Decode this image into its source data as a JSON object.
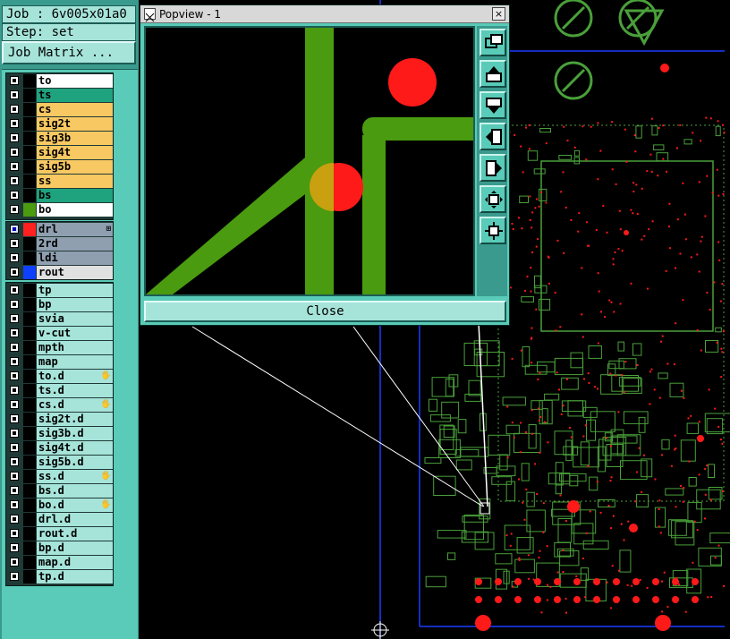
{
  "job": {
    "label": "Job : 6v005x01a0",
    "step": "Step: set"
  },
  "job_matrix_label": "Job Matrix ...",
  "layers": [
    {
      "name": "to",
      "color": "#ffffff",
      "swatch": "#000000",
      "group": 0
    },
    {
      "name": "ts",
      "color": "#1fa37e",
      "swatch": "#000000",
      "group": 0
    },
    {
      "name": "cs",
      "color": "#f8c862",
      "swatch": "#000000",
      "group": 0
    },
    {
      "name": "sig2t",
      "color": "#f8c862",
      "swatch": "#000000",
      "group": 0
    },
    {
      "name": "sig3b",
      "color": "#f8c862",
      "swatch": "#000000",
      "group": 0
    },
    {
      "name": "sig4t",
      "color": "#f8c862",
      "swatch": "#000000",
      "group": 0
    },
    {
      "name": "sig5b",
      "color": "#f8c862",
      "swatch": "#000000",
      "group": 0
    },
    {
      "name": "ss",
      "color": "#f8c862",
      "swatch": "#000000",
      "group": 0
    },
    {
      "name": "bs",
      "color": "#1fa37e",
      "swatch": "#000000",
      "group": 0
    },
    {
      "name": "bo",
      "color": "#ffffff",
      "swatch": "#4a9b10",
      "group": 0
    },
    {
      "name": "drl",
      "color": "#8f9fb0",
      "swatch": "#ff2020",
      "group": 1,
      "selected": true,
      "icon": "⊞"
    },
    {
      "name": "2rd",
      "color": "#8f9fb0",
      "swatch": "#000000",
      "group": 1
    },
    {
      "name": "ldi",
      "color": "#8f9fb0",
      "swatch": "#000000",
      "group": 1
    },
    {
      "name": "rout",
      "color": "#e0e0e0",
      "swatch": "#1040ff",
      "group": 1
    },
    {
      "name": "tp",
      "color": "#a6e4da",
      "swatch": "#000000",
      "group": 2
    },
    {
      "name": "bp",
      "color": "#a6e4da",
      "swatch": "#000000",
      "group": 2
    },
    {
      "name": "svia",
      "color": "#a6e4da",
      "swatch": "#000000",
      "group": 2
    },
    {
      "name": "v-cut",
      "color": "#a6e4da",
      "swatch": "#000000",
      "group": 2
    },
    {
      "name": "mpth",
      "color": "#a6e4da",
      "swatch": "#000000",
      "group": 2
    },
    {
      "name": "map",
      "color": "#a6e4da",
      "swatch": "#000000",
      "group": 2
    },
    {
      "name": "to.d",
      "color": "#a6e4da",
      "swatch": "#000000",
      "group": 2,
      "icon": "🖐"
    },
    {
      "name": "ts.d",
      "color": "#a6e4da",
      "swatch": "#000000",
      "group": 2
    },
    {
      "name": "cs.d",
      "color": "#a6e4da",
      "swatch": "#000000",
      "group": 2,
      "icon": "🖐"
    },
    {
      "name": "sig2t.d",
      "color": "#a6e4da",
      "swatch": "#000000",
      "group": 2
    },
    {
      "name": "sig3b.d",
      "color": "#a6e4da",
      "swatch": "#000000",
      "group": 2
    },
    {
      "name": "sig4t.d",
      "color": "#a6e4da",
      "swatch": "#000000",
      "group": 2
    },
    {
      "name": "sig5b.d",
      "color": "#a6e4da",
      "swatch": "#000000",
      "group": 2
    },
    {
      "name": "ss.d",
      "color": "#a6e4da",
      "swatch": "#000000",
      "group": 2,
      "icon": "🖐"
    },
    {
      "name": "bs.d",
      "color": "#a6e4da",
      "swatch": "#000000",
      "group": 2
    },
    {
      "name": "bo.d",
      "color": "#a6e4da",
      "swatch": "#000000",
      "group": 2,
      "icon": "🖐"
    },
    {
      "name": "drl.d",
      "color": "#a6e4da",
      "swatch": "#000000",
      "group": 2
    },
    {
      "name": "rout.d",
      "color": "#a6e4da",
      "swatch": "#000000",
      "group": 2
    },
    {
      "name": "bp.d",
      "color": "#a6e4da",
      "swatch": "#000000",
      "group": 2
    },
    {
      "name": "map.d",
      "color": "#a6e4da",
      "swatch": "#000000",
      "group": 2
    },
    {
      "name": "tp.d",
      "color": "#a6e4da",
      "swatch": "#000000",
      "group": 2
    }
  ],
  "popview": {
    "title": "Popview - 1",
    "close_label": "Close",
    "close_x": "×",
    "tools": [
      "zoom-fit-icon",
      "pan-up-icon",
      "pan-down-icon",
      "pan-left-icon",
      "pan-right-icon",
      "zoom-in-icon",
      "zoom-out-icon"
    ]
  },
  "colors": {
    "trace": "#4a9b10",
    "pad": "#ff1a1a",
    "outline": "#4aa03a",
    "profile": "#1a3cff",
    "panel": "#59cbb8"
  }
}
